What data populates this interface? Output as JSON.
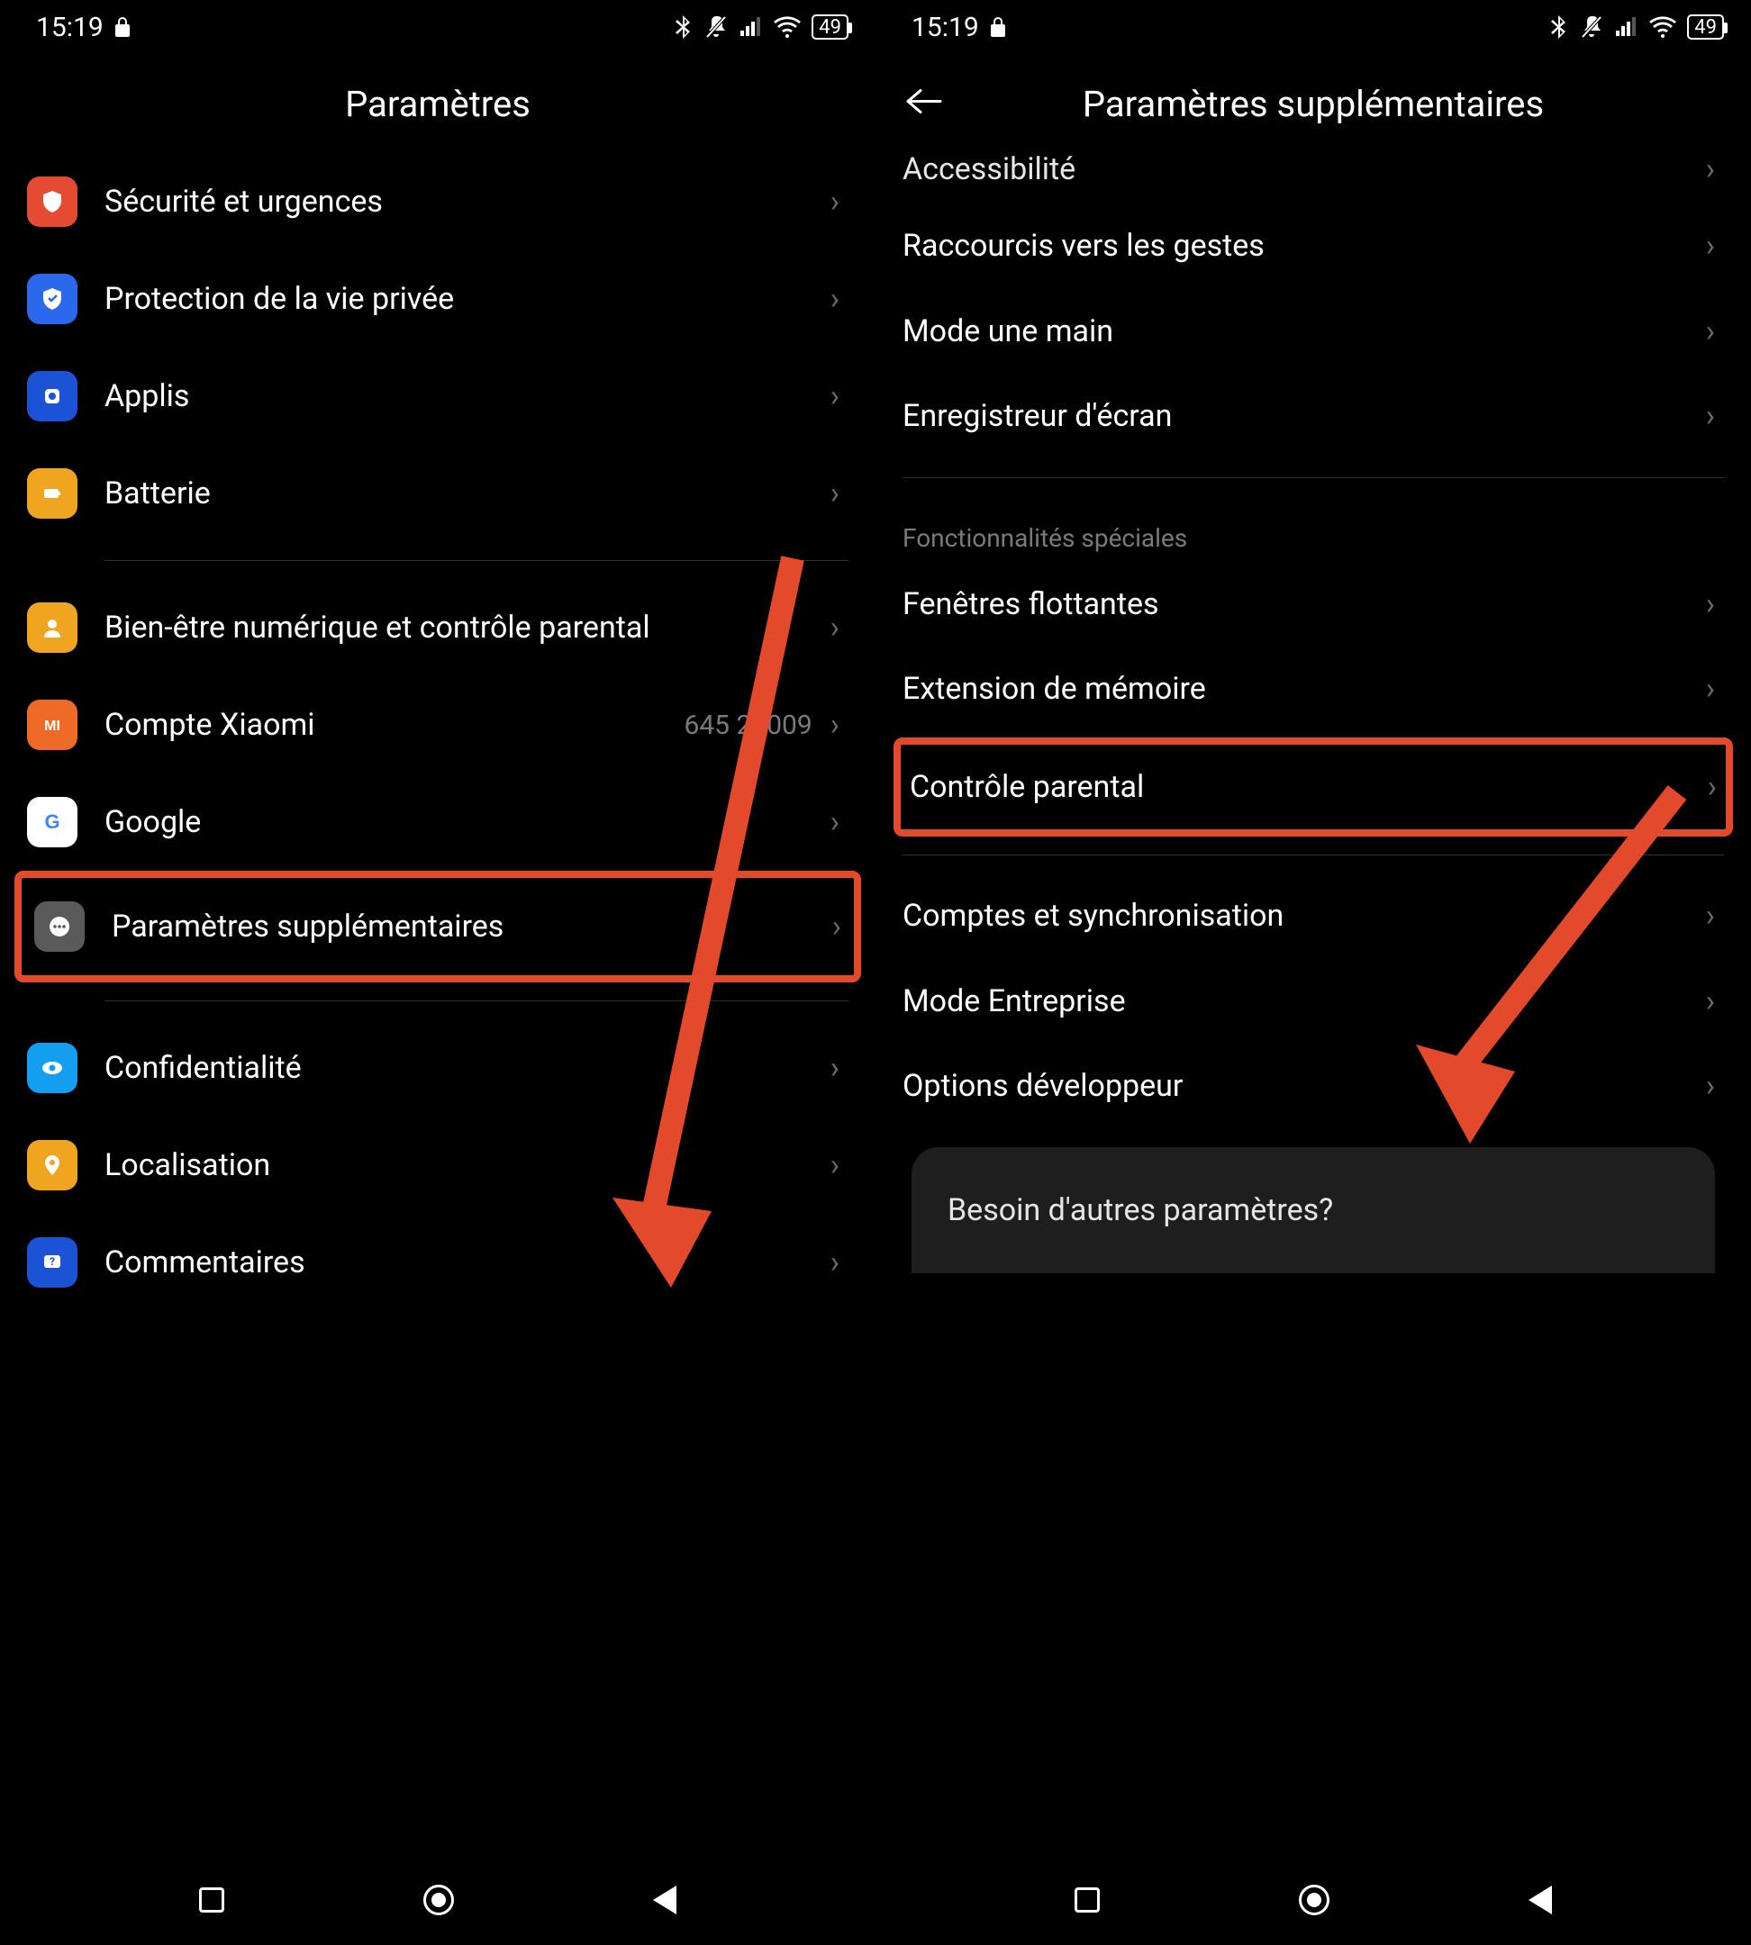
{
  "status": {
    "time": "15:19",
    "battery_level": "49"
  },
  "left_screen": {
    "title": "Paramètres",
    "items": [
      {
        "label": "Sécurité et urgences"
      },
      {
        "label": "Protection de la vie privée"
      },
      {
        "label": "Applis"
      },
      {
        "label": "Batterie"
      }
    ],
    "items2": [
      {
        "label": "Bien-être numérique et contrôle parental"
      },
      {
        "label": "Compte Xiaomi",
        "value": "645   25009"
      },
      {
        "label": "Google"
      },
      {
        "label": "Paramètres supplémentaires"
      }
    ],
    "items3": [
      {
        "label": "Confidentialité"
      },
      {
        "label": "Localisation"
      },
      {
        "label": "Commentaires"
      }
    ]
  },
  "right_screen": {
    "title": "Paramètres supplémentaires",
    "partial_top": "Accessibilité",
    "items": [
      {
        "label": "Raccourcis vers les gestes"
      },
      {
        "label": "Mode une main"
      },
      {
        "label": "Enregistreur d'écran"
      }
    ],
    "section_label": "Fonctionnalités spéciales",
    "items2": [
      {
        "label": "Fenêtres flottantes"
      },
      {
        "label": "Extension de mémoire"
      },
      {
        "label": "Contrôle parental"
      }
    ],
    "items3": [
      {
        "label": "Comptes et synchronisation"
      },
      {
        "label": "Mode Entreprise"
      },
      {
        "label": "Options développeur"
      }
    ],
    "footer": "Besoin d'autres paramètres?"
  },
  "annotation_color": "#e34a2b"
}
